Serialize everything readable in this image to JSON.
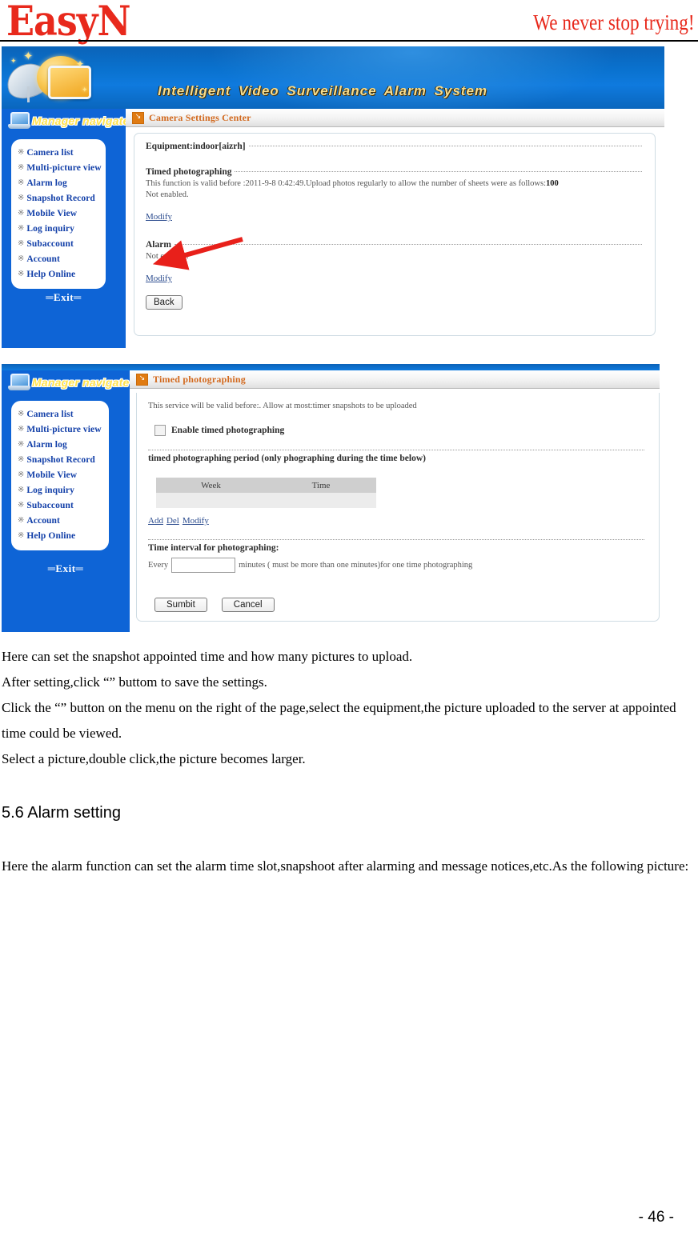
{
  "brand": {
    "logo": "EasyN",
    "tagline": "We never stop trying!"
  },
  "banner": {
    "title": "Intelligent  Video  Surveillance  Alarm  System"
  },
  "sidebar": {
    "nav_header": "Manager navigate",
    "bullet": "※",
    "items": [
      {
        "label": "Camera list"
      },
      {
        "label": "Multi-picture view"
      },
      {
        "label": "Alarm log"
      },
      {
        "label": "Snapshot Record"
      },
      {
        "label": "Mobile View"
      },
      {
        "label": "Log inquiry"
      },
      {
        "label": "Subaccount"
      },
      {
        "label": "Account"
      },
      {
        "label": "Help Online"
      }
    ],
    "exit": "═Exit═"
  },
  "screenshot1": {
    "titlebar": {
      "icon": "arrow-box-icon",
      "text": "Camera Settings Center"
    },
    "equipment_label": "Equipment:indoor[aizrh]",
    "timed": {
      "heading": "Timed photographing",
      "valid_text": "This function is valid before :2011-9-8 0:42:49.Upload photos regularly to allow the number of sheets were as follows:",
      "sheets_count": "100",
      "status": "Not enabled.",
      "modify_link": "Modify"
    },
    "alarm": {
      "heading": "Alarm",
      "status": "Not enabled.",
      "modify_link": "Modify"
    },
    "back_button": "Back",
    "annotation": {
      "type": "red-arrow",
      "color": "#e8201a",
      "points_to": "Modify"
    }
  },
  "screenshot2": {
    "titlebar": {
      "icon": "arrow-box-icon",
      "text": "Timed photographing"
    },
    "notice": "This service will be valid before:. Allow at most:timer snapshots to be uploaded",
    "enable_checkbox": {
      "label": "Enable timed photographing",
      "checked": false
    },
    "period_heading": "timed photographing period (only phographing during the time below)",
    "period_table": {
      "columns": [
        "Week",
        "Time"
      ],
      "rows": [
        [
          "",
          ""
        ]
      ]
    },
    "row_actions": [
      "Add",
      "Del",
      "Modify"
    ],
    "interval_heading": "Time interval for photographing:",
    "interval": {
      "prefix": "Every",
      "value": "",
      "suffix": "minutes ( must be more than one minutes)for one time photographing"
    },
    "buttons": {
      "submit": "Sumbit",
      "cancel": "Cancel"
    }
  },
  "body_text": {
    "line1": "Here can set the snapshot appointed time and how many pictures to upload.",
    "line2": "After setting,click “” buttom to save the settings.",
    "line3": "Click the “” button on the menu on the right of the page,select the equipment,the picture uploaded to the server at appointed time could be viewed.",
    "line4": "Select a picture,double click,the picture becomes larger."
  },
  "section": {
    "heading": "5.6 Alarm setting",
    "paragraph": "Here the alarm function can set the alarm time slot,snapshoot after alarming and message notices,etc.As the following picture:"
  },
  "footer": {
    "page_number": "- 46 -"
  },
  "colors": {
    "brand_red": "#e8291c",
    "banner_blue": "#0a72cf",
    "sidebar_blue": "#0e64d6",
    "nav_label_blue": "#123fa8",
    "title_orange": "#d2691e",
    "annotation_red": "#e8201a"
  }
}
